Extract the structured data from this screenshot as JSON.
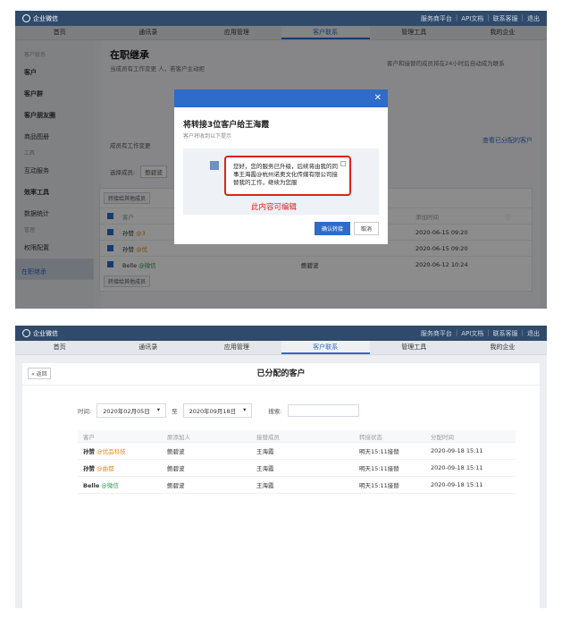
{
  "topbar": {
    "brand": "企业微信",
    "links": [
      "服务商平台",
      "API文档",
      "联系客服",
      "退出"
    ]
  },
  "nav": [
    "首页",
    "通讯录",
    "应用管理",
    "客户联系",
    "管理工具",
    "我的企业"
  ],
  "nav_active": 3,
  "shot1": {
    "sidebar": [
      {
        "label": "客户联系",
        "kind": "group"
      },
      {
        "label": "客户",
        "kind": "bold"
      },
      {
        "label": "客户群",
        "kind": "bold"
      },
      {
        "label": "客户朋友圈",
        "kind": "bold"
      },
      {
        "label": "商品图册",
        "kind": "item"
      },
      {
        "label": "工具",
        "kind": "group"
      },
      {
        "label": "互动服务",
        "kind": "item"
      },
      {
        "label": "效率工具",
        "kind": "bold"
      },
      {
        "label": "数据统计",
        "kind": "item"
      },
      {
        "label": "管理",
        "kind": "group"
      },
      {
        "label": "权限配置",
        "kind": "item"
      },
      {
        "label": "在职继承",
        "kind": "sel"
      }
    ],
    "page_title": "在职继承",
    "desc": "当成员有工作变更 人，若客户主动拒",
    "desc_right": "客户和接替的成员将在24小时后自动成为联系",
    "label_a": "成员有工作变更",
    "label_b": "选择成员:",
    "label_b_val": "鲍碧波",
    "view_assigned": "查看已分配的客户",
    "transfer_btn": "转接给其他成员",
    "table_head": [
      "客户",
      "添加时间"
    ],
    "rows": [
      {
        "name": "孙赞",
        "tag": "@3",
        "tagcolor": "orange",
        "owner": "",
        "time": "2020-06-15 09:20"
      },
      {
        "name": "孙赞",
        "tag": "@优",
        "tagcolor": "orange",
        "owner": "",
        "time": "2020-06-15 09:20"
      },
      {
        "name": "Belle",
        "tag": "@微信",
        "tagcolor": "green",
        "owner": "鲍碧波",
        "time": "2020-06-12 10:24"
      }
    ],
    "modal": {
      "title": "将转接3位客户给王海霞",
      "subtitle": "客户将收到以下提示",
      "message": "您好，您的服务已升级，后续将由我的同事王海霞@杭州诺奥文化传媒有限公司接替我的工作，继续为您服",
      "annotation": "此内容可编辑",
      "confirm": "确认转接",
      "cancel": "取消"
    }
  },
  "shot2": {
    "back": "« 返回",
    "title": "已分配的客户",
    "time_label": "时间:",
    "date_from": "2020年02月05日",
    "to": "至",
    "date_to": "2020年09月18日",
    "search_label": "搜索:",
    "headers": [
      "客户",
      "原添加人",
      "接替成员",
      "转接状态",
      "分配时间"
    ],
    "rows": [
      {
        "name": "孙赞",
        "tag": "@优品科技",
        "tagcolor": "orange",
        "orig": "鲍碧波",
        "succ": "王海霞",
        "status": "明天15:11接替",
        "time": "2020-09-18 15:11"
      },
      {
        "name": "孙赞",
        "tag": "@曲都",
        "tagcolor": "orange",
        "orig": "鲍碧波",
        "succ": "王海霞",
        "status": "明天15:11接替",
        "time": "2020-09-18 15:11"
      },
      {
        "name": "Belle",
        "tag": "@微信",
        "tagcolor": "green",
        "orig": "鲍碧波",
        "succ": "王海霞",
        "status": "明天15:11接替",
        "time": "2020-09-18 15:11"
      }
    ]
  }
}
